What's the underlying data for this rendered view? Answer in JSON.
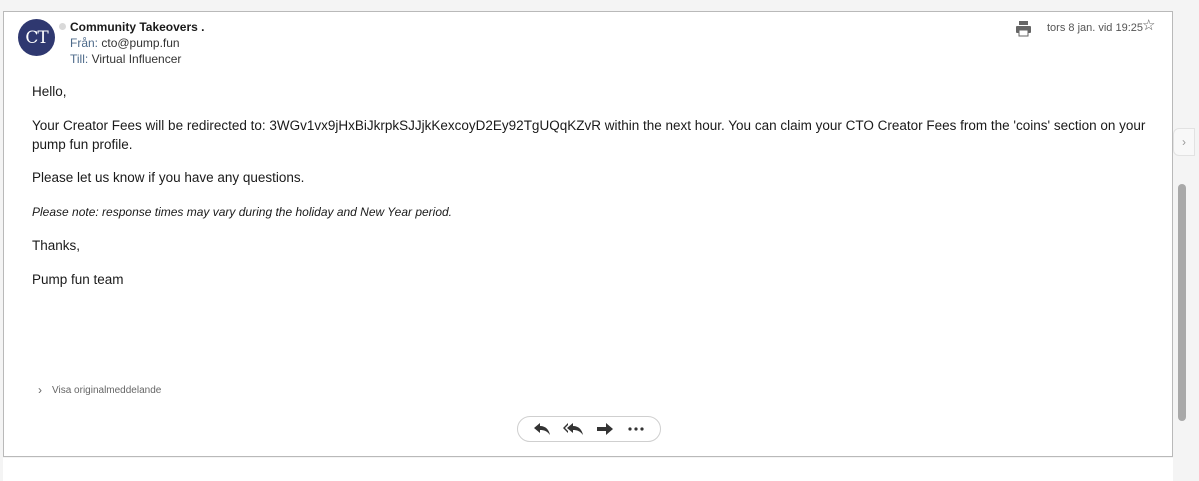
{
  "email": {
    "avatar_text": "CT",
    "sender_name": "Community Takeovers .",
    "from_label": "Från:",
    "from_value": "cto@pump.fun",
    "to_label": "Till:",
    "to_value": "Virtual Influencer",
    "date": "tors 8 jan. vid 19:25",
    "body": {
      "greeting": "Hello,",
      "paragraph1": "Your Creator Fees will be redirected to: 3WGv1vx9jHxBiJkrpkSJJjkKexcoyD2Ey92TgUQqKZvR within the next hour. You can claim your CTO Creator Fees from the 'coins' section on your pump fun profile.",
      "paragraph2": "Please let us know if you have any questions.",
      "note": "Please note: response times may vary during the holiday and New Year period.",
      "closing": "Thanks,",
      "signature": "Pump fun team"
    },
    "show_original_label": "Visa originalmeddelande"
  },
  "icons": {
    "print": "print-icon",
    "star": "star-icon",
    "reply": "reply-icon",
    "reply_all": "reply-all-icon",
    "forward": "forward-icon",
    "more": "more-icon"
  },
  "colors": {
    "avatar_bg": "#2f3870",
    "label_color": "#4d6a8a"
  }
}
